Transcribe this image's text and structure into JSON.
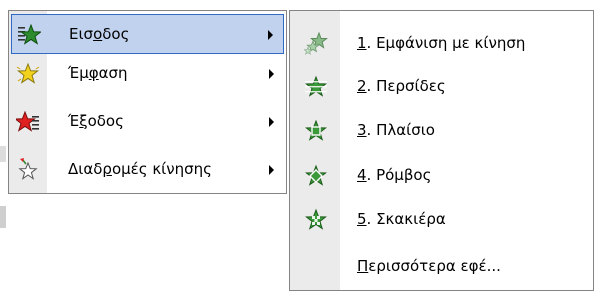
{
  "colors": {
    "highlight_fill": "#c1d2ee",
    "highlight_border": "#316ac5",
    "gutter": "#ebebeb",
    "entrance_green": "#2c8b2c",
    "emphasis_yellow": "#f2d21c",
    "exit_red": "#e02020"
  },
  "menu": {
    "items": [
      {
        "id": "entrance",
        "icon": "entrance-effect-star-icon",
        "pre": "Εισ",
        "accel": "ο",
        "post": "δος",
        "has_submenu": true,
        "highlighted": true
      },
      {
        "id": "emphasis",
        "icon": "emphasis-effect-star-icon",
        "pre": "Έμ",
        "accel": "φ",
        "post": "αση",
        "has_submenu": true,
        "highlighted": false
      },
      {
        "id": "exit",
        "icon": "exit-effect-star-icon",
        "pre": "Έ",
        "accel": "ξ",
        "post": "οδος",
        "has_submenu": true,
        "highlighted": false
      },
      {
        "id": "motion-paths",
        "icon": "motion-path-star-icon",
        "pre": "Διαδ",
        "accel": "ρ",
        "post": "ομές κίνησης",
        "has_submenu": true,
        "highlighted": false
      }
    ]
  },
  "submenu": {
    "items": [
      {
        "id": "fly-in",
        "icon": "fly-in-effect-icon",
        "pre": "",
        "accel": "1",
        "post": ". Εμφάνιση με κίνηση"
      },
      {
        "id": "blinds",
        "icon": "blinds-effect-icon",
        "pre": "",
        "accel": "2",
        "post": ". Περσίδες"
      },
      {
        "id": "box",
        "icon": "box-effect-icon",
        "pre": "",
        "accel": "3",
        "post": ". Πλαίσιο"
      },
      {
        "id": "diamond",
        "icon": "diamond-effect-icon",
        "pre": "",
        "accel": "4",
        "post": ". Ρόμβος"
      },
      {
        "id": "checkerboard",
        "icon": "checkerboard-effect-icon",
        "pre": "",
        "accel": "5",
        "post": ". Σκακιέρα"
      },
      {
        "id": "more-effects",
        "icon": "",
        "pre": "",
        "accel": "Π",
        "post": "ερισσότερα εφέ..."
      }
    ]
  }
}
